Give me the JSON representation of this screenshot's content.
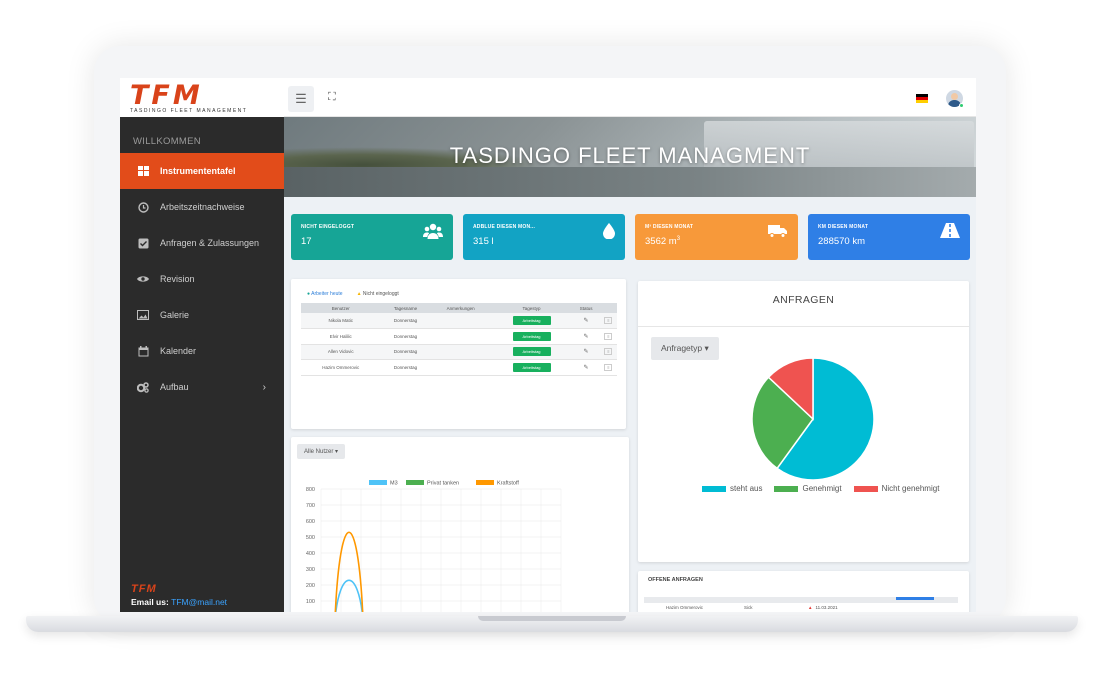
{
  "brand": {
    "logo_text": "TFM",
    "logo_sub": "TASDINGO FLEET MANAGEMENT"
  },
  "sidebar": {
    "welcome": "WILLKOMMEN",
    "items": [
      {
        "label": "Instrumententafel",
        "icon": "dashboard-icon"
      },
      {
        "label": "Arbeitszeitnachweise",
        "icon": "clock-icon"
      },
      {
        "label": "Anfragen & Zulassungen",
        "icon": "checkbox-icon"
      },
      {
        "label": "Revision",
        "icon": "eye-icon"
      },
      {
        "label": "Galerie",
        "icon": "image-icon"
      },
      {
        "label": "Kalender",
        "icon": "calendar-icon"
      },
      {
        "label": "Aufbau",
        "icon": "gears-icon"
      }
    ],
    "footer_logo": "TFM",
    "email_label": "Email us:",
    "email": "TFM@mail.net"
  },
  "banner": {
    "title": "TASDINGO FLEET MANAGMENT"
  },
  "stats": [
    {
      "label": "NICHT EINGELOGGT",
      "value": "17",
      "icon": "users-icon",
      "color": "#16a596"
    },
    {
      "label": "ADBLUE DIESEN MON...",
      "value": "315 l",
      "icon": "drop-icon",
      "color": "#12a3c4"
    },
    {
      "label": "M³ DIESEN MONAT",
      "value": "3562 m",
      "sup": "3",
      "icon": "truck-icon",
      "color": "#f7993a"
    },
    {
      "label": "KM DIESEN MONAT",
      "value": "288570 km",
      "icon": "road-icon",
      "color": "#2f7fe6"
    }
  ],
  "workers": {
    "legend_a": "Arbeiter heute",
    "legend_b": "Nicht eingeloggt",
    "headers": [
      "Benutzer",
      "Tagesname",
      "Anmerkungen",
      "Tagestyp",
      "Status",
      ""
    ],
    "rows": [
      {
        "user": "Nikola Matic",
        "day": "Donnerstag",
        "note": "",
        "type": "Arbeitstag"
      },
      {
        "user": "Elvir Halilic",
        "day": "Donnerstag",
        "note": "",
        "type": "Arbeitstag"
      },
      {
        "user": "Allen Vidovic",
        "day": "Donnerstag",
        "note": "",
        "type": "Arbeitstag"
      },
      {
        "user": "Hazim Ommerovic",
        "day": "Donnerstag",
        "note": "",
        "type": "Arbeitstag"
      }
    ]
  },
  "filter": {
    "all_users": "Alle Nutzer"
  },
  "chart_data": [
    {
      "type": "line",
      "series": [
        {
          "name": "M3",
          "color": "#4fc3f7",
          "values": [
            0,
            310,
            0
          ]
        },
        {
          "name": "Privat tanken",
          "color": "#4caf50",
          "values": [
            0,
            0,
            0
          ]
        },
        {
          "name": "Kraftstoff",
          "color": "#ff9800",
          "values": [
            0,
            710,
            0
          ]
        }
      ],
      "yticks": [
        "800",
        "700",
        "600",
        "500",
        "400",
        "300",
        "200",
        "100"
      ],
      "ylim": [
        0,
        800
      ]
    },
    {
      "type": "pie",
      "title": "ANFRAGEN",
      "categories": [
        "steht aus",
        "Genehmigt",
        "Nicht genehmigt"
      ],
      "values": [
        60,
        27,
        13
      ],
      "colors": [
        "#00bcd4",
        "#4caf50",
        "#ef5350"
      ]
    }
  ],
  "requests": {
    "dropdown": "Anfragetyp",
    "title": "ANFRAGEN"
  },
  "open_requests": {
    "title": "OFFENE ANFRAGEN",
    "row_user": "Hazim Ommerovic",
    "row_type": "Sick",
    "row_date": "11.03.2021"
  }
}
